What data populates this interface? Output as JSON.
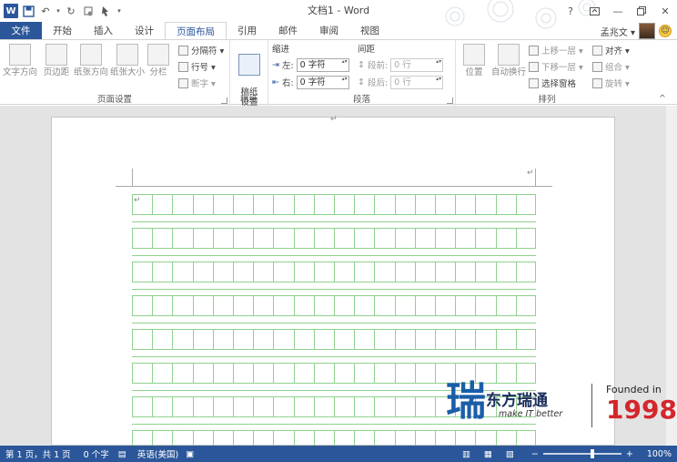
{
  "window": {
    "title": "文档1 - Word",
    "help": "?"
  },
  "tabs": [
    {
      "label": "文件"
    },
    {
      "label": "开始"
    },
    {
      "label": "插入"
    },
    {
      "label": "设计"
    },
    {
      "label": "页面布局"
    },
    {
      "label": "引用"
    },
    {
      "label": "邮件"
    },
    {
      "label": "审阅"
    },
    {
      "label": "视图"
    }
  ],
  "user": {
    "name": "孟兆文 ▾"
  },
  "ribbon": {
    "page_setup": {
      "label": "页面设置",
      "text_direction": "文字方向",
      "margins": "页边距",
      "orientation": "纸张方向",
      "size": "纸张大小",
      "columns": "分栏",
      "breaks": "分隔符 ▾",
      "line_numbers": "行号 ▾",
      "hyphenation": "断字 ▾"
    },
    "manuscript": {
      "label": "稿纸",
      "setup": "稿纸\n设置"
    },
    "paragraph": {
      "label": "段落",
      "indent": "缩进",
      "spacing": "间距",
      "left": "左:",
      "right": "右:",
      "left_value": "0 字符",
      "right_value": "0 字符",
      "before": "段前:",
      "after": "段后:",
      "before_value": "0 行",
      "after_value": "0 行"
    },
    "arrange": {
      "label": "排列",
      "position": "位置",
      "wrap": "自动换行",
      "bring_forward": "上移一层 ▾",
      "send_backward": "下移一层 ▾",
      "selection_pane": "选择窗格",
      "align": "对齐 ▾",
      "group": "组合 ▾",
      "rotate": "旋转 ▾"
    }
  },
  "document": {
    "rows": 8,
    "cols": 20,
    "mark": "↵"
  },
  "status": {
    "page": "第 1 页，共 1 页",
    "words": "0 个字",
    "lang": "英语(美国)",
    "zoom": "100%",
    "minus": "−",
    "plus": "+"
  },
  "brand": {
    "cn": "东方瑞通",
    "slogan": "make IT better",
    "founded": "Founded in",
    "year": "1998",
    "glyph": "瑞",
    "brand_blue": "#1a5ea8",
    "brand_red": "#d4262c"
  },
  "colors": {
    "accent": "#2b579a",
    "grid": "#8fd18f"
  }
}
